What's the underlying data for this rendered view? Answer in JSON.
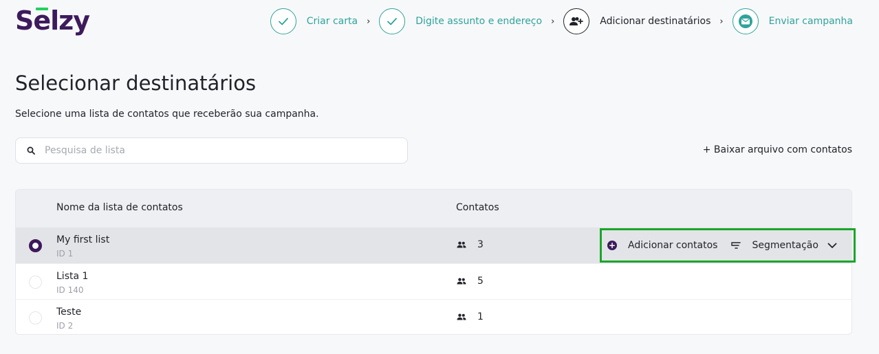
{
  "brand": {
    "logo": "Selzy",
    "accent": "#1fd35e",
    "primary": "#3d1a5c"
  },
  "steps": [
    {
      "label": "Criar carta",
      "icon": "check-icon",
      "state": "done"
    },
    {
      "label": "Digite assunto e endereço",
      "icon": "check-icon",
      "state": "done"
    },
    {
      "label": "Adicionar destinatários",
      "icon": "add-user-icon",
      "state": "active"
    },
    {
      "label": "Enviar campanha",
      "icon": "envelope-icon",
      "state": "pending"
    }
  ],
  "page": {
    "title": "Selecionar destinatários",
    "subtitle": "Selecione uma lista de contatos que receberão sua campanha."
  },
  "search": {
    "placeholder": "Pesquisa de lista",
    "value": ""
  },
  "download_label": "+ Baixar arquivo com contatos",
  "table": {
    "columns": [
      "Nome da lista de contatos",
      "Contatos"
    ],
    "rows": [
      {
        "name": "My first list",
        "id": "ID 1",
        "contacts": "3",
        "selected": true
      },
      {
        "name": "Lista 1",
        "id": "ID 140",
        "contacts": "5",
        "selected": false
      },
      {
        "name": "Teste",
        "id": "ID 2",
        "contacts": "1",
        "selected": false
      }
    ]
  },
  "row_actions": {
    "add_contacts": "Adicionar contatos",
    "segmentation": "Segmentação"
  },
  "colors": {
    "teal": "#2ea39b",
    "highlight_border": "#1aa52a"
  }
}
